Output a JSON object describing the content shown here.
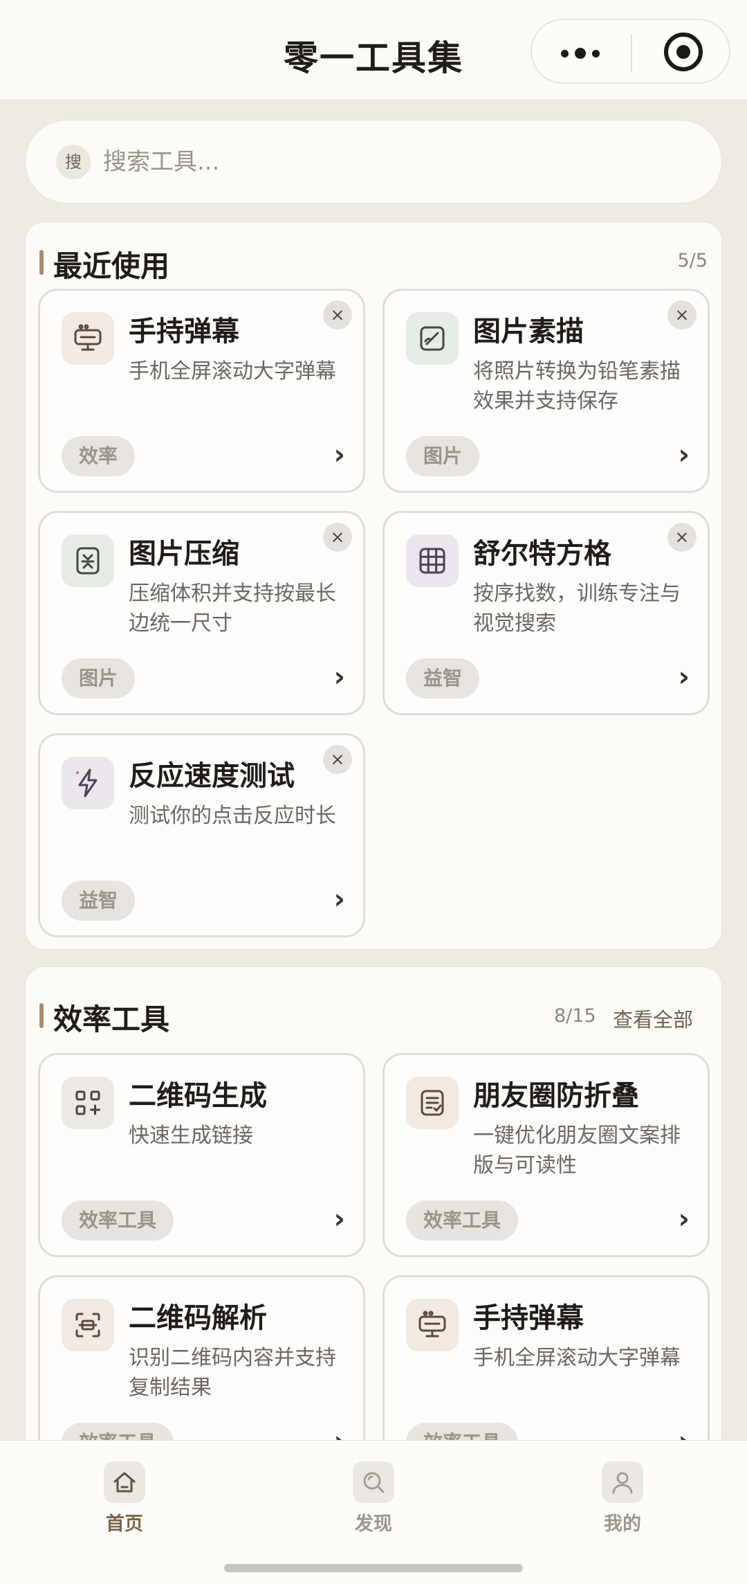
{
  "header": {
    "title": "零一工具集"
  },
  "search": {
    "icon_text": "搜",
    "placeholder": "搜索工具..."
  },
  "recent": {
    "title": "最近使用",
    "count": "5/5",
    "items": [
      {
        "title": "手持弹幕",
        "desc": "手机全屏滚动大字弹幕",
        "tag": "效率",
        "icon": "banner-sign-icon"
      },
      {
        "title": "图片素描",
        "desc": "将照片转换为铅笔素描效果并支持保存",
        "tag": "图片",
        "icon": "sketch-frame-icon"
      },
      {
        "title": "图片压缩",
        "desc": "压缩体积并支持按最长边统一尺寸",
        "tag": "图片",
        "icon": "compress-icon"
      },
      {
        "title": "舒尔特方格",
        "desc": "按序找数，训练专注与视觉搜索",
        "tag": "益智",
        "icon": "grid-icon"
      },
      {
        "title": "反应速度测试",
        "desc": "测试你的点击反应时长",
        "tag": "益智",
        "icon": "lightning-icon"
      }
    ],
    "close_symbol": "×",
    "chevron_symbol": "›"
  },
  "efficiency": {
    "title": "效率工具",
    "count": "8/15",
    "link": "查看全部",
    "items": [
      {
        "title": "二维码生成",
        "desc": "快速生成链接",
        "tag": "效率工具",
        "icon": "qr-generate-icon"
      },
      {
        "title": "朋友圈防折叠",
        "desc": "一键优化朋友圈文案排版与可读性",
        "tag": "效率工具",
        "icon": "document-check-icon"
      },
      {
        "title": "二维码解析",
        "desc": "识别二维码内容并支持复制结果",
        "tag": "效率工具",
        "icon": "qr-scan-icon"
      },
      {
        "title": "手持弹幕",
        "desc": "手机全屏滚动大字弹幕",
        "tag": "效率工具",
        "icon": "banner-sign-icon"
      }
    ]
  },
  "tabbar": {
    "items": [
      {
        "label": "首页",
        "icon": "home-icon",
        "active": true
      },
      {
        "label": "发现",
        "icon": "search-icon",
        "active": false
      },
      {
        "label": "我的",
        "icon": "user-icon",
        "active": false
      }
    ]
  },
  "colors": {
    "accent": "#a88d72",
    "background": "#efebe4",
    "card": "#fefdfb",
    "active_tab": "#7c6348"
  }
}
